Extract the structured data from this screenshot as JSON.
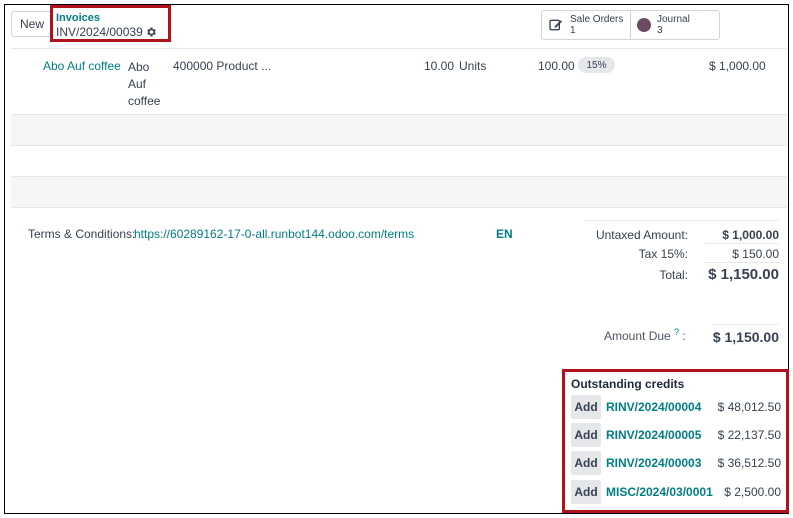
{
  "toolbar": {
    "new_label": "New"
  },
  "breadcrumb": {
    "parent": "Invoices",
    "current": "INV/2024/00039"
  },
  "smart_buttons": [
    {
      "label": "Sale Orders",
      "count": "1",
      "icon": "pencil-square-icon"
    },
    {
      "label": "Journal",
      "count": "3",
      "icon": "journal-dot-icon"
    }
  ],
  "line_item": {
    "product": "Abo Auf coffee",
    "label_lines": [
      "Abo",
      "Auf",
      "coffee"
    ],
    "account": "400000 Product ...",
    "quantity": "10.00",
    "uom": "Units",
    "price": "100.00",
    "tax": "15%",
    "subtotal": "$ 1,000.00"
  },
  "terms": {
    "label": "Terms & Conditions:",
    "link": "https://60289162-17-0-all.runbot144.odoo.com/terms",
    "lang": "EN"
  },
  "totals": {
    "untaxed_label": "Untaxed Amount:",
    "untaxed_value": "$ 1,000.00",
    "tax_label": "Tax 15%:",
    "tax_value": "$ 150.00",
    "total_label": "Total:",
    "total_value": "$ 1,150.00",
    "amount_due_label": "Amount Due",
    "amount_due_help": "?",
    "amount_due_colon": ":",
    "amount_due_value": "$ 1,150.00"
  },
  "outstanding": {
    "title": "Outstanding credits",
    "add_label": "Add",
    "items": [
      {
        "ref": "RINV/2024/00004",
        "amount": "$ 48,012.50"
      },
      {
        "ref": "RINV/2024/00005",
        "amount": "$ 22,137.50"
      },
      {
        "ref": "RINV/2024/00003",
        "amount": "$ 36,512.50"
      },
      {
        "ref": "MISC/2024/03/0001",
        "amount": "$ 2,500.00"
      }
    ]
  },
  "colors": {
    "accent": "#017e84",
    "highlight": "#b0121b",
    "journal_dot": "#6b4b64"
  }
}
